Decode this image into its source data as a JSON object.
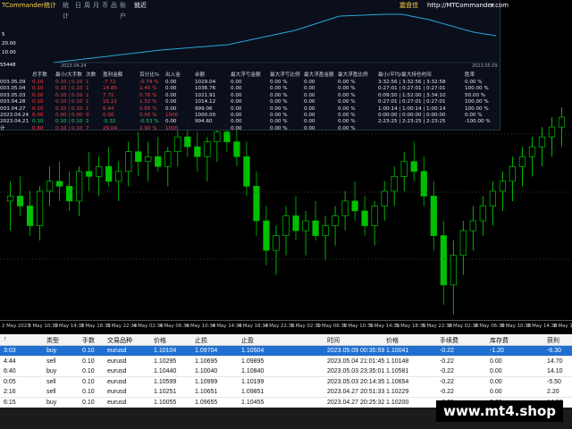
{
  "app": {
    "title": "TCommander统计",
    "menu": [
      "统计",
      "日",
      "周",
      "月",
      "币",
      "品",
      "账户"
    ],
    "selected_period": "就近",
    "right_title": "震盘佳",
    "url": "http://MTCommander.com",
    "close": "×"
  },
  "equity_chart": {
    "start_date": "2023.04.24",
    "end_date": "2023.05.09",
    "left_values": [
      "5",
      "20.00",
      "10.00"
    ],
    "left_label": "55448"
  },
  "stats": {
    "headers": [
      "总手数",
      "最小/大手数",
      "次数",
      "盈利金额",
      "百分比%",
      "出入金",
      "余额",
      "最大浮亏金额",
      "最大浮亏比例",
      "最大浮盈金额",
      "最大浮盈比例",
      "最小/平均/最大持仓时间",
      "胜率"
    ],
    "rows": [
      {
        "label": "003.05.09",
        "total": "0.10",
        "minmax": "0.10 | 0.10",
        "count": "1",
        "profit": "-7.72",
        "pct": "-0.74 %",
        "io": "0.00",
        "balance": "1029.04",
        "fl_amt": "0.00",
        "fl_pct": "0.00 %",
        "fp_amt": "0.00",
        "fp_pct": "0.00 %",
        "time": "3:32:56 | 3:32:56 | 3:32:58",
        "win": "0.00 %",
        "color": "red"
      },
      {
        "label": "003.05.04",
        "total": "0.10",
        "minmax": "0.10 | 0.10",
        "count": "1",
        "profit": "14.85",
        "pct": "1.45 %",
        "io": "0.00",
        "balance": "1036.76",
        "fl_amt": "0.00",
        "fl_pct": "0.00 %",
        "fp_amt": "0.00",
        "fp_pct": "0.00 %",
        "time": "0:27:01 | 0:27:01 | 0:27:01",
        "win": "100.00 %",
        "color": "red"
      },
      {
        "label": "003.05.03",
        "total": "0.20",
        "minmax": "0.10 | 0.10",
        "count": "2",
        "profit": "7.71",
        "pct": "0.76 %",
        "io": "0.00",
        "balance": "1021.91",
        "fl_amt": "0.00",
        "fl_pct": "0.00 %",
        "fp_amt": "0.00",
        "fp_pct": "0.00 %",
        "time": "0:09:50 | 1:52:00 | 3:34:10",
        "win": "50.00 %",
        "color": "red"
      },
      {
        "label": "003.04.28",
        "total": "0.10",
        "minmax": "0.10 | 0.10",
        "count": "1",
        "profit": "15.21",
        "pct": "1.52 %",
        "io": "0.00",
        "balance": "1014.12",
        "fl_amt": "0.00",
        "fl_pct": "0.00 %",
        "fp_amt": "0.00",
        "fp_pct": "0.00 %",
        "time": "0:27:01 | 0:27:01 | 0:27:01",
        "win": "100.00 %",
        "color": "red"
      },
      {
        "label": "003.04.27",
        "total": "0.10",
        "minmax": "0.10 | 0.10",
        "count": "1",
        "profit": "6.44",
        "pct": "0.65 %",
        "io": "0.00",
        "balance": "999.06",
        "fl_amt": "0.00",
        "fl_pct": "0.00 %",
        "fp_amt": "0.00",
        "fp_pct": "0.00 %",
        "time": "1:00:14 | 1:00:14 | 1:00:14",
        "win": "100.00 %",
        "color": "red"
      },
      {
        "label": "2023.04.24",
        "total": "0.00",
        "minmax": "0.00 | 0.00",
        "count": "0",
        "profit": "0.00",
        "pct": "0.00 %",
        "io": "1000",
        "balance": "1000.00",
        "fl_amt": "0.00",
        "fl_pct": "0.00 %",
        "fp_amt": "0.00",
        "fp_pct": "0.00 %",
        "time": "0:00:00 | 0:00:00 | 0:00:00",
        "win": "0.00 %",
        "color": "red"
      },
      {
        "label": "2023.04.21",
        "total": "0.10",
        "minmax": "0.10 | 0.10",
        "count": "1",
        "profit": "-5.32",
        "pct": "-0.53 %",
        "io": "0.00",
        "balance": "994.60",
        "fl_amt": "0.00",
        "fl_pct": "0.00 %",
        "fp_amt": "0.00",
        "fp_pct": "0.00 %",
        "time": "2:23:25 | 2:23:25 | 2:23:25",
        "win": "-100.00 %",
        "color": "green"
      },
      {
        "label": "计",
        "total": "0.80",
        "minmax": "0.10 | 0.10",
        "count": "7",
        "profit": "29.04",
        "pct": "2.90 %",
        "io": "1000",
        "balance": "",
        "fl_amt": "0.00",
        "fl_pct": "0.00 %",
        "fp_amt": "0.00",
        "fp_pct": "0.00 %",
        "time": "",
        "win": "",
        "color": "red"
      }
    ]
  },
  "time_axis": [
    "2 May 2023",
    "3 May 10:30",
    "3 May 14:30",
    "3 May 18:30",
    "3 May 22:30",
    "4 May 02:30",
    "4 May 06:30",
    "4 May 10:30",
    "4 May 14:30",
    "4 May 18:30",
    "4 May 22:30",
    "5 May 02:30",
    "5 May 06:30",
    "5 May 10:30",
    "5 May 14:30",
    "5 May 18:30",
    "5 May 22:30",
    "8 May 02:30",
    "8 May 06:30",
    "8 May 10:30",
    "8 May 14:30",
    "8 May 18:30"
  ],
  "orders": {
    "headers": [
      "↑",
      "类型",
      "手数",
      "交易品种",
      "价格",
      "止损",
      "止盈",
      "时间",
      "价格",
      "手续费",
      "库存费",
      "获利"
    ],
    "rows": [
      {
        "time_open": "3:03",
        "type": "buy",
        "lots": "0.10",
        "symbol": "eurusd",
        "price": "1.10104",
        "sl": "1.09704",
        "tp": "1.10504",
        "time_close": "2023.05.09 00:35:59",
        "close_price": "1.10041",
        "commission": "-0.22",
        "swap": "-1.20",
        "profit": "-6.30",
        "selected": true
      },
      {
        "time_open": "4:44",
        "type": "sell",
        "lots": "0.10",
        "symbol": "eurusd",
        "price": "1.10295",
        "sl": "1.10695",
        "tp": "1.09895",
        "time_close": "2023.05.04 21:01:45",
        "close_price": "1.10148",
        "commission": "-0.22",
        "swap": "0.00",
        "profit": "14.70",
        "selected": false
      },
      {
        "time_open": "6:40",
        "type": "buy",
        "lots": "0.10",
        "symbol": "eurusd",
        "price": "1.10440",
        "sl": "1.10040",
        "tp": "1.10840",
        "time_close": "2023.05.03 23:35:01",
        "close_price": "1.10581",
        "commission": "-0.22",
        "swap": "0.00",
        "profit": "14.10",
        "selected": false
      },
      {
        "time_open": "0:05",
        "type": "sell",
        "lots": "0.10",
        "symbol": "eurusd",
        "price": "1.10599",
        "sl": "1.10999",
        "tp": "1.10199",
        "time_close": "2023.05.03 20:14:35",
        "close_price": "1.10654",
        "commission": "-0.22",
        "swap": "0.00",
        "profit": "-5.50",
        "selected": false
      },
      {
        "time_open": "2:16",
        "type": "sell",
        "lots": "0.10",
        "symbol": "eurusd",
        "price": "1.10251",
        "sl": "1.10651",
        "tp": "1.09851",
        "time_close": "2023.04.27 20:51:33",
        "close_price": "1.10229",
        "commission": "-0.22",
        "swap": "0.00",
        "profit": "2.20",
        "selected": false
      },
      {
        "time_open": "6:15",
        "type": "buy",
        "lots": "0.10",
        "symbol": "eurusd",
        "price": "1.10055",
        "sl": "1.09655",
        "tp": "1.10455",
        "time_close": "2023.04.27 20:25:32",
        "close_price": "1.10200",
        "commission": "-0.22",
        "swap": "0.00",
        "profit": "14.50",
        "selected": false
      }
    ]
  },
  "watermark": "www.mt4.shop",
  "colors": {
    "candle_up": "#00e000",
    "candle_down": "#00c000",
    "equity_line": "#2aa7d8",
    "selected_row": "#1f6fd1"
  },
  "candles": [
    {
      "o": 1.1009,
      "h": 1.1013,
      "l": 1.1003,
      "c": 1.101
    },
    {
      "o": 1.101,
      "h": 1.1014,
      "l": 1.1006,
      "c": 1.1008
    },
    {
      "o": 1.1008,
      "h": 1.1011,
      "l": 1.1002,
      "c": 1.1004
    },
    {
      "o": 1.1004,
      "h": 1.1012,
      "l": 1.1001,
      "c": 1.1011
    },
    {
      "o": 1.1011,
      "h": 1.1016,
      "l": 1.1008,
      "c": 1.1013
    },
    {
      "o": 1.1013,
      "h": 1.1017,
      "l": 1.1009,
      "c": 1.1012
    },
    {
      "o": 1.1012,
      "h": 1.1015,
      "l": 1.1007,
      "c": 1.1009
    },
    {
      "o": 1.1009,
      "h": 1.1016,
      "l": 1.1006,
      "c": 1.1015
    },
    {
      "o": 1.1015,
      "h": 1.1019,
      "l": 1.1011,
      "c": 1.1014
    },
    {
      "o": 1.1014,
      "h": 1.1018,
      "l": 1.101,
      "c": 1.1016
    },
    {
      "o": 1.1016,
      "h": 1.102,
      "l": 1.1012,
      "c": 1.1013
    },
    {
      "o": 1.1013,
      "h": 1.1017,
      "l": 1.1009,
      "c": 1.1015
    },
    {
      "o": 1.1015,
      "h": 1.1021,
      "l": 1.1012,
      "c": 1.1019
    },
    {
      "o": 1.1019,
      "h": 1.1023,
      "l": 1.1014,
      "c": 1.1017
    },
    {
      "o": 1.1017,
      "h": 1.1021,
      "l": 1.1013,
      "c": 1.1018
    },
    {
      "o": 1.1018,
      "h": 1.1022,
      "l": 1.1015,
      "c": 1.1016
    },
    {
      "o": 1.1016,
      "h": 1.102,
      "l": 1.1012,
      "c": 1.1019
    },
    {
      "o": 1.1019,
      "h": 1.1024,
      "l": 1.1016,
      "c": 1.1022
    },
    {
      "o": 1.1022,
      "h": 1.1026,
      "l": 1.1018,
      "c": 1.102
    },
    {
      "o": 1.102,
      "h": 1.1023,
      "l": 1.1015,
      "c": 1.1018
    },
    {
      "o": 1.1018,
      "h": 1.1022,
      "l": 1.1013,
      "c": 1.1021
    },
    {
      "o": 1.1021,
      "h": 1.1025,
      "l": 1.1017,
      "c": 1.1023
    },
    {
      "o": 1.1023,
      "h": 1.1027,
      "l": 1.1019,
      "c": 1.1021
    },
    {
      "o": 1.1021,
      "h": 1.1024,
      "l": 1.1016,
      "c": 1.1018
    },
    {
      "o": 1.1018,
      "h": 1.1021,
      "l": 1.101,
      "c": 1.1012
    },
    {
      "o": 1.1012,
      "h": 1.1015,
      "l": 1.1002,
      "c": 1.1005
    },
    {
      "o": 1.1005,
      "h": 1.1008,
      "l": 1.0996,
      "c": 1.0999
    },
    {
      "o": 1.0999,
      "h": 1.1004,
      "l": 1.0994,
      "c": 1.1002
    },
    {
      "o": 1.1002,
      "h": 1.1008,
      "l": 1.0998,
      "c": 1.1006
    },
    {
      "o": 1.1006,
      "h": 1.101,
      "l": 1.1001,
      "c": 1.1003
    },
    {
      "o": 1.1003,
      "h": 1.1007,
      "l": 1.0998,
      "c": 1.1005
    },
    {
      "o": 1.1005,
      "h": 1.1009,
      "l": 1.1001,
      "c": 1.1002
    },
    {
      "o": 1.1002,
      "h": 1.1006,
      "l": 1.0997,
      "c": 1.1004
    },
    {
      "o": 1.1004,
      "h": 1.1008,
      "l": 1.1,
      "c": 1.1006
    },
    {
      "o": 1.1006,
      "h": 1.1011,
      "l": 1.1003,
      "c": 1.1009
    },
    {
      "o": 1.1009,
      "h": 1.1013,
      "l": 1.1005,
      "c": 1.1007
    },
    {
      "o": 1.1007,
      "h": 1.101,
      "l": 1.1002,
      "c": 1.1004
    },
    {
      "o": 1.1004,
      "h": 1.1009,
      "l": 1.1,
      "c": 1.1008
    },
    {
      "o": 1.1008,
      "h": 1.1013,
      "l": 1.1005,
      "c": 1.1011
    },
    {
      "o": 1.1011,
      "h": 1.1016,
      "l": 1.1008,
      "c": 1.1014
    },
    {
      "o": 1.1014,
      "h": 1.1019,
      "l": 1.1011,
      "c": 1.1017
    },
    {
      "o": 1.1017,
      "h": 1.1021,
      "l": 1.1013,
      "c": 1.1015
    },
    {
      "o": 1.1015,
      "h": 1.1018,
      "l": 1.1008,
      "c": 1.101
    },
    {
      "o": 1.101,
      "h": 1.1013,
      "l": 1.0999,
      "c": 1.1002
    },
    {
      "o": 1.1002,
      "h": 1.1005,
      "l": 1.0988,
      "c": 1.0992
    },
    {
      "o": 1.0992,
      "h": 1.1001,
      "l": 1.0986,
      "c": 1.0998
    },
    {
      "o": 1.0998,
      "h": 1.1005,
      "l": 1.0994,
      "c": 1.1003
    },
    {
      "o": 1.1003,
      "h": 1.1008,
      "l": 1.0999,
      "c": 1.1005
    },
    {
      "o": 1.1005,
      "h": 1.101,
      "l": 1.1002,
      "c": 1.1008
    },
    {
      "o": 1.1008,
      "h": 1.1013,
      "l": 1.1004,
      "c": 1.1011
    },
    {
      "o": 1.1011,
      "h": 1.1015,
      "l": 1.1007,
      "c": 1.1013
    },
    {
      "o": 1.1013,
      "h": 1.1018,
      "l": 1.1009,
      "c": 1.1016
    },
    {
      "o": 1.1016,
      "h": 1.102,
      "l": 1.1012,
      "c": 1.1018
    },
    {
      "o": 1.1018,
      "h": 1.1022,
      "l": 1.1014,
      "c": 1.102
    },
    {
      "o": 1.102,
      "h": 1.1024,
      "l": 1.1016,
      "c": 1.1022
    },
    {
      "o": 1.1022,
      "h": 1.1026,
      "l": 1.1018,
      "c": 1.1024
    },
    {
      "o": 1.1024,
      "h": 1.1028,
      "l": 1.102,
      "c": 1.1026
    }
  ]
}
